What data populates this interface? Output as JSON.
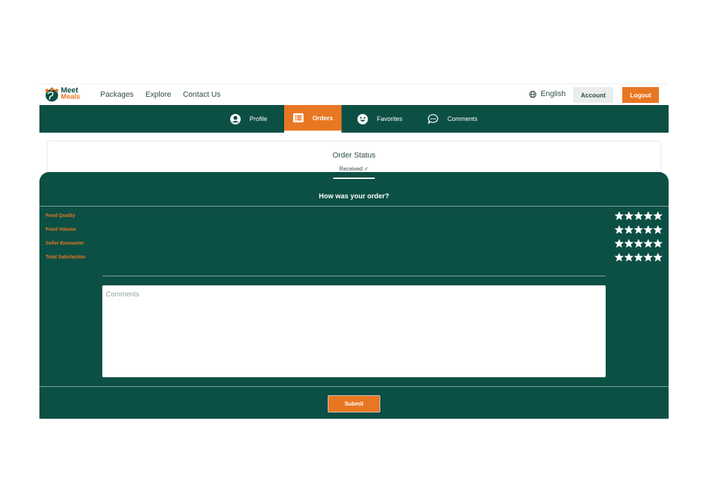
{
  "navbar": {
    "logo": {
      "line1": "Meet",
      "line2": "Meals"
    },
    "links": [
      "Packages",
      "Explore",
      "Contact Us"
    ],
    "language": "English",
    "account_label": "Account",
    "logout_label": "Logout"
  },
  "tabs": [
    {
      "label": "Profile",
      "icon": "profile-icon",
      "active": false
    },
    {
      "label": "Orders",
      "icon": "orders-icon",
      "active": true
    },
    {
      "label": "Favorites",
      "icon": "smiley-icon",
      "active": false
    },
    {
      "label": "Comments",
      "icon": "chat-icon",
      "active": false
    }
  ],
  "order_status": {
    "title": "Order Status",
    "value": "Received ✓"
  },
  "review": {
    "title": "How was your order?",
    "ratings": [
      {
        "label": "Food Quality",
        "stars": 5,
        "max": 5
      },
      {
        "label": "Food Volume",
        "stars": 5,
        "max": 5
      },
      {
        "label": "Seller Encounter",
        "stars": 5,
        "max": 5
      },
      {
        "label": "Total Satisfaction",
        "stars": 5,
        "max": 5
      }
    ],
    "comments_placeholder": "Comments",
    "submit_label": "Submit"
  },
  "colors": {
    "brand_green": "#0c4f44",
    "brand_orange": "#e87722"
  }
}
